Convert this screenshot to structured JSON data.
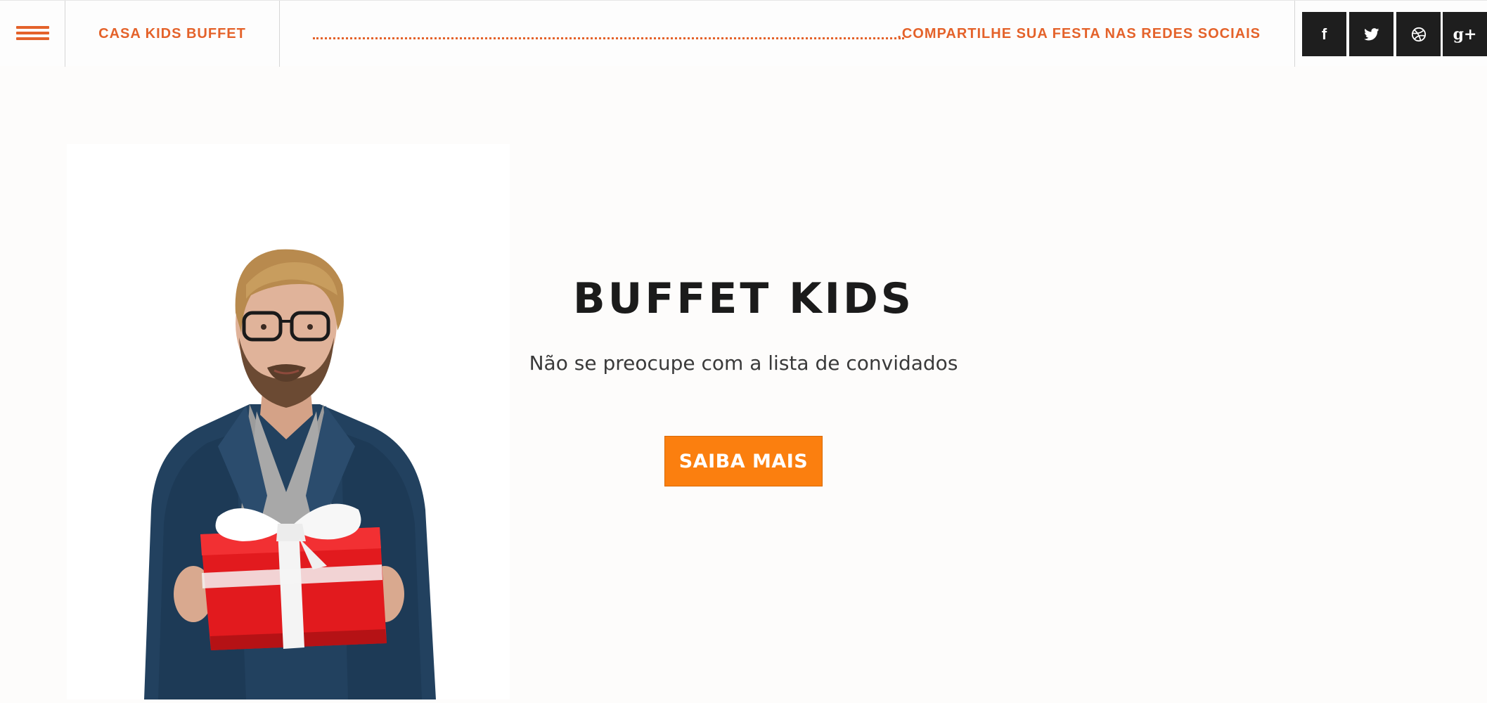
{
  "header": {
    "brand": "CASA KIDS BUFFET",
    "share_text": ".COMPARTILHE SUA FESTA NAS REDES SOCIAIS",
    "accent_color": "#e4622a",
    "social": [
      {
        "icon": "facebook-icon",
        "glyph": "f"
      },
      {
        "icon": "twitter-icon"
      },
      {
        "icon": "dribbble-icon"
      },
      {
        "icon": "google-plus-icon",
        "glyph": "g+"
      }
    ]
  },
  "hero": {
    "title": "BUFFET KIDS",
    "subtitle": "Não se preocupe com a lista de convidados",
    "cta_label": "SAIBA MAIS",
    "cta_color": "#fb7f0f",
    "image": "man-holding-red-gift-box"
  }
}
